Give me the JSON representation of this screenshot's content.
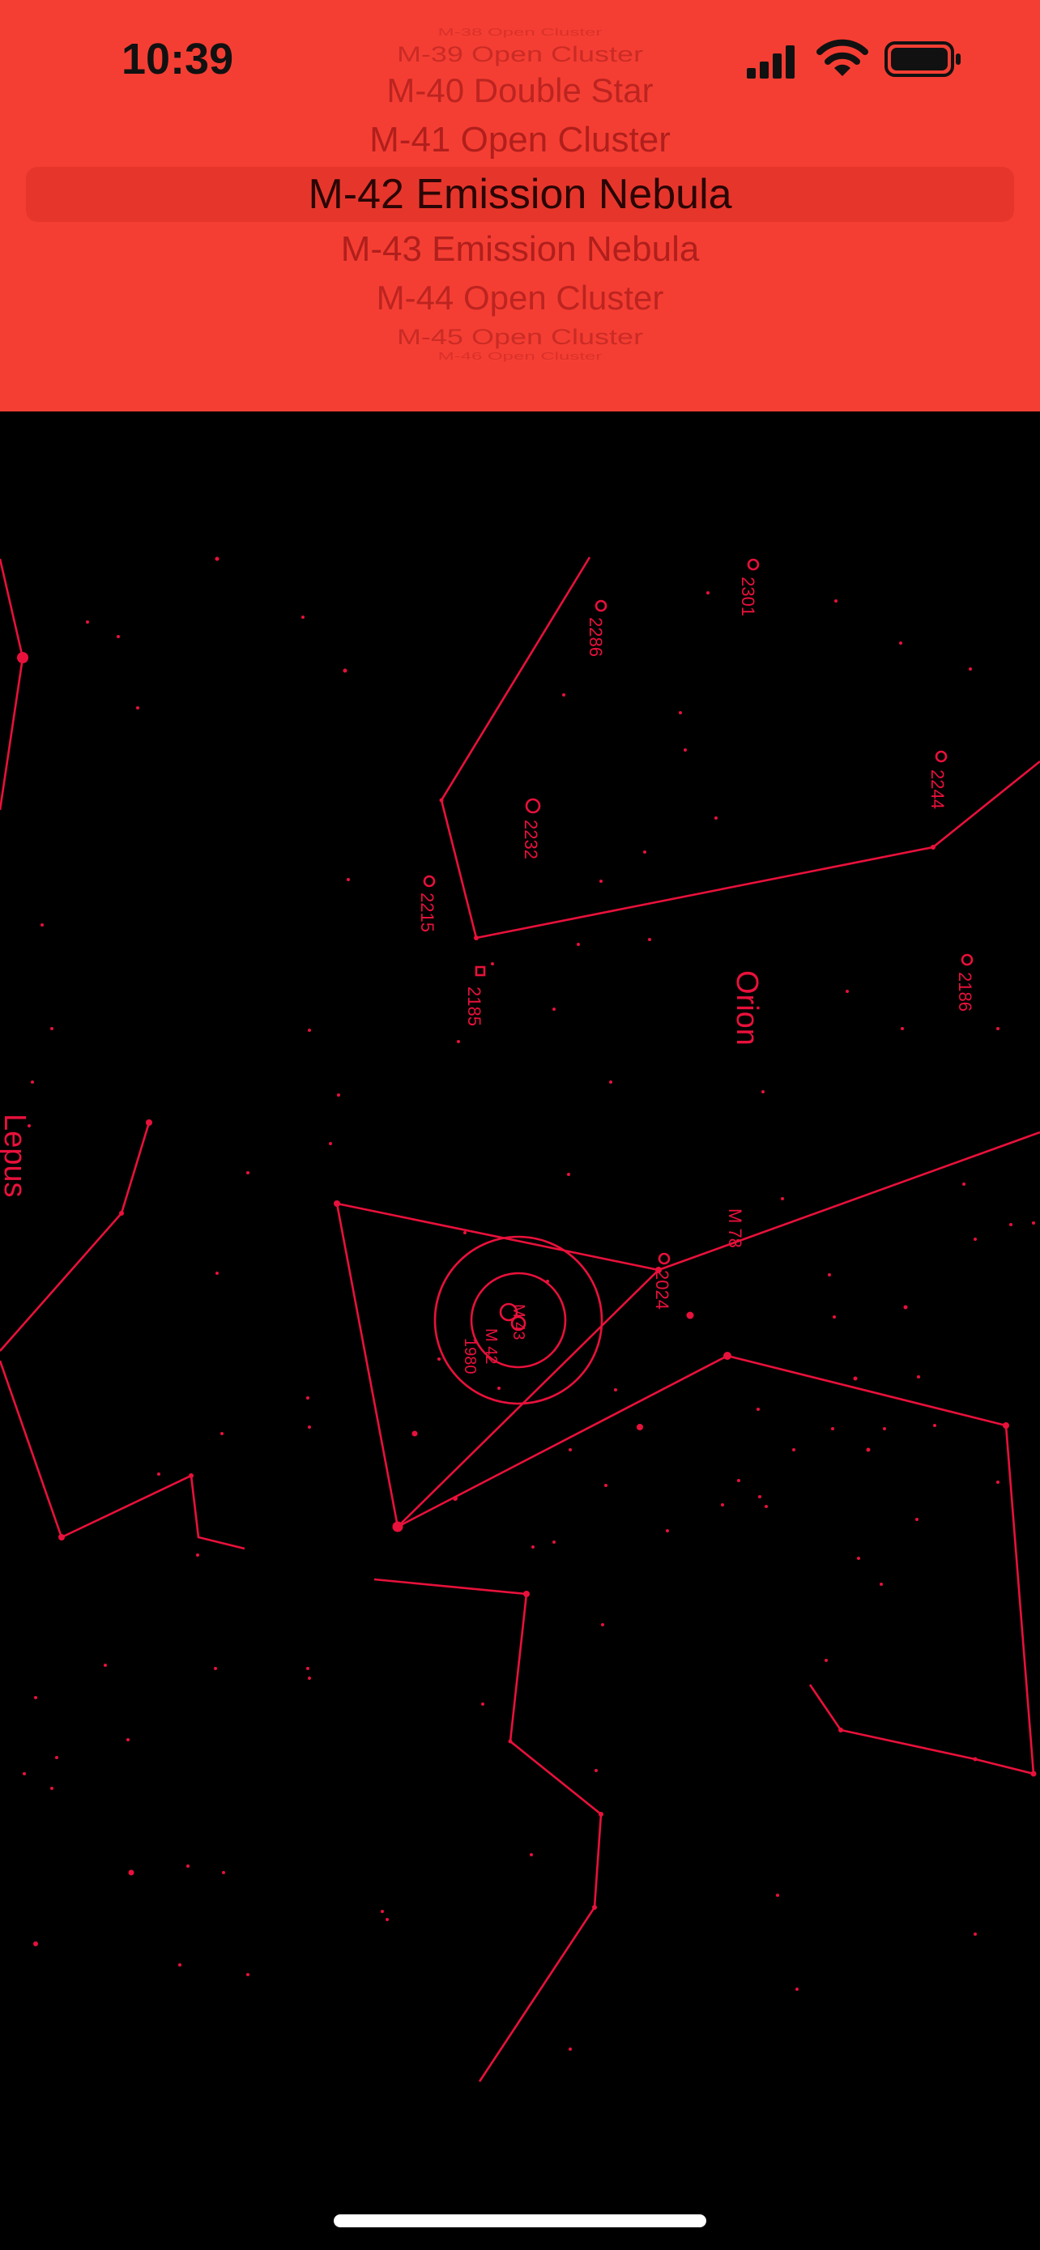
{
  "status_bar": {
    "time": "10:39"
  },
  "picker": {
    "selected_index": 4,
    "items": [
      "M-38 Open Cluster",
      "M-39 Open Cluster",
      "M-40 Double Star",
      "M-41 Open Cluster",
      "M-42 Emission Nebula",
      "M-43 Emission Nebula",
      "M-44 Open Cluster",
      "M-45 Open Cluster",
      "M-46 Open Cluster"
    ]
  },
  "map": {
    "constellations": [
      "Orion",
      "Lepus"
    ],
    "labels": [
      "2301",
      "2286",
      "2244",
      "2232",
      "2215",
      "2185",
      "2186",
      "M 78",
      "2024",
      "M 43",
      "M 42",
      "1980"
    ]
  },
  "colors": {
    "header": "#f53e33",
    "chart_ink": "#e8113b",
    "background": "#000000"
  }
}
